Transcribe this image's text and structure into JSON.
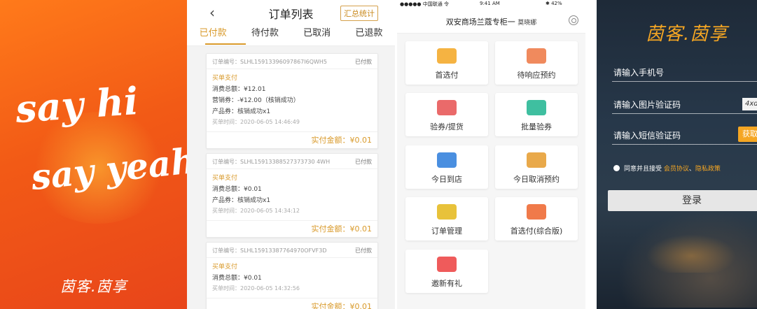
{
  "splash": {
    "line1": "say hi",
    "line2": "say yeah",
    "brand": "茵客.茵享"
  },
  "orders": {
    "title": "订单列表",
    "summary_button": "汇总统计",
    "tabs": [
      "已付款",
      "待付款",
      "已取消",
      "已退款"
    ],
    "cards": [
      {
        "order_no": "订单编号：SLHL15913396097867I6QWH5",
        "status": "已付款",
        "type": "买单支付",
        "lines": [
          "消费总额：¥12.01",
          "营销券：-¥12.00（核销成功）",
          "产品券：核销成功x1"
        ],
        "time": "买单时间：2020-06-05 14:46:49",
        "amount": "实付金额：¥0.01"
      },
      {
        "order_no": "订单编号：SLHL15913388527373730 4WH",
        "status": "已付款",
        "type": "买单支付",
        "lines": [
          "消费总额：¥0.01",
          "产品券：核销成功x1"
        ],
        "time": "买单时间：2020-06-05 14:34:12",
        "amount": "实付金额：¥0.01"
      },
      {
        "order_no": "订单编号：SLHL15913387764970OFVF3D",
        "status": "已付款",
        "type": "买单支付",
        "lines": [
          "消费总额：¥0.01"
        ],
        "time": "买单时间：2020-06-05 14:32:56",
        "amount": "实付金额：¥0.01"
      }
    ]
  },
  "grid": {
    "status_carrier": "●●●●● 中国联通 令",
    "status_time": "9:41 AM",
    "status_battery": "✱ 42%",
    "title": "双安商场兰蔻专柜一",
    "subtitle": "莫晓娜",
    "tiles": [
      {
        "label": "首选付",
        "color": "#f5b342"
      },
      {
        "label": "待响应预约",
        "color": "#f08a5d"
      },
      {
        "label": "验券/提货",
        "color": "#ea6a6a"
      },
      {
        "label": "批量验券",
        "color": "#3fbfa0"
      },
      {
        "label": "今日到店",
        "color": "#4a8fe0"
      },
      {
        "label": "今日取消预约",
        "color": "#e9a94a"
      },
      {
        "label": "订单管理",
        "color": "#e8c23a"
      },
      {
        "label": "首选付(综合版)",
        "color": "#f07a4a"
      },
      {
        "label": "邀新有礼",
        "color": "#ef5b5b"
      }
    ]
  },
  "login": {
    "brand": "茵客.茵享",
    "phone_placeholder": "请输入手机号",
    "image_code_placeholder": "请输入图片验证码",
    "captcha_text": "4xd8",
    "sms_placeholder": "请输入短信验证码",
    "get_code": "获取验",
    "agree_text": "同意并且接受",
    "member_agreement": "会员协议",
    "separator": "、",
    "privacy": "隐私政策",
    "login_button": "登录"
  }
}
